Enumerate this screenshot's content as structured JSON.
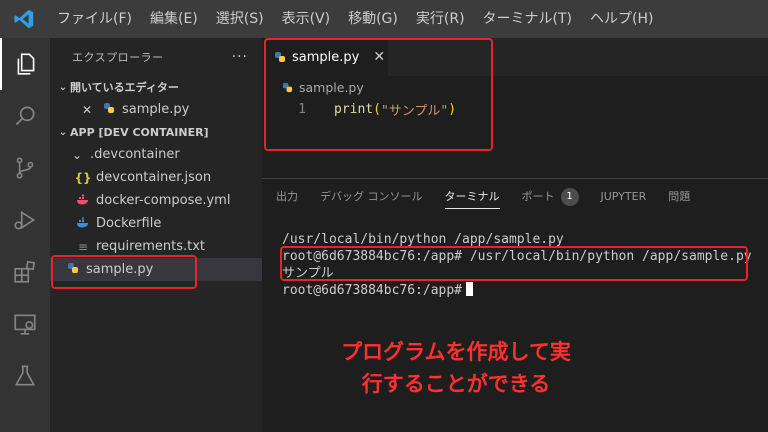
{
  "menu": [
    "ファイル(F)",
    "編集(E)",
    "選択(S)",
    "表示(V)",
    "移動(G)",
    "実行(R)",
    "ターミナル(T)",
    "ヘルプ(H)"
  ],
  "sidebar": {
    "title": "エクスプローラー",
    "more": "···",
    "open_editors": {
      "header": "開いているエディター",
      "items": [
        {
          "close": "✕",
          "name": "sample.py"
        }
      ]
    },
    "workspace": {
      "header": "APP [DEV CONTAINER]",
      "items": [
        {
          "name": ".devcontainer",
          "icon": "chevron-down-icon"
        },
        {
          "name": "devcontainer.json",
          "icon": "json-icon",
          "glyph": "{}"
        },
        {
          "name": "docker-compose.yml",
          "icon": "docker-icon"
        },
        {
          "name": "Dockerfile",
          "icon": "docker-icon"
        },
        {
          "name": "requirements.txt",
          "icon": "text-file-icon"
        },
        {
          "name": "sample.py",
          "icon": "python-icon"
        }
      ]
    }
  },
  "editor": {
    "tab_label": "sample.py",
    "tab_close": "✕",
    "breadcrumb": "sample.py",
    "line_number": "1",
    "code": {
      "fn": "print",
      "open": "(",
      "str": "\"サンプル\"",
      "close": ")"
    }
  },
  "panel": {
    "tabs": [
      "出力",
      "デバッグ コンソール",
      "ターミナル",
      "ポート",
      "JUPYTER",
      "問題"
    ],
    "active_tab": "ターミナル",
    "port_count": "1",
    "terminal": [
      "/usr/local/bin/python /app/sample.py",
      "root@6d673884bc76:/app# /usr/local/bin/python /app/sample.py",
      "サンプル",
      "root@6d673884bc76:/app#"
    ]
  },
  "annotation": {
    "line1": "プログラムを作成して実",
    "line2": "行することができる",
    "color": "#ff3030"
  },
  "colors": {
    "accent": "#007acc",
    "highlight_border": "#e8232b"
  }
}
